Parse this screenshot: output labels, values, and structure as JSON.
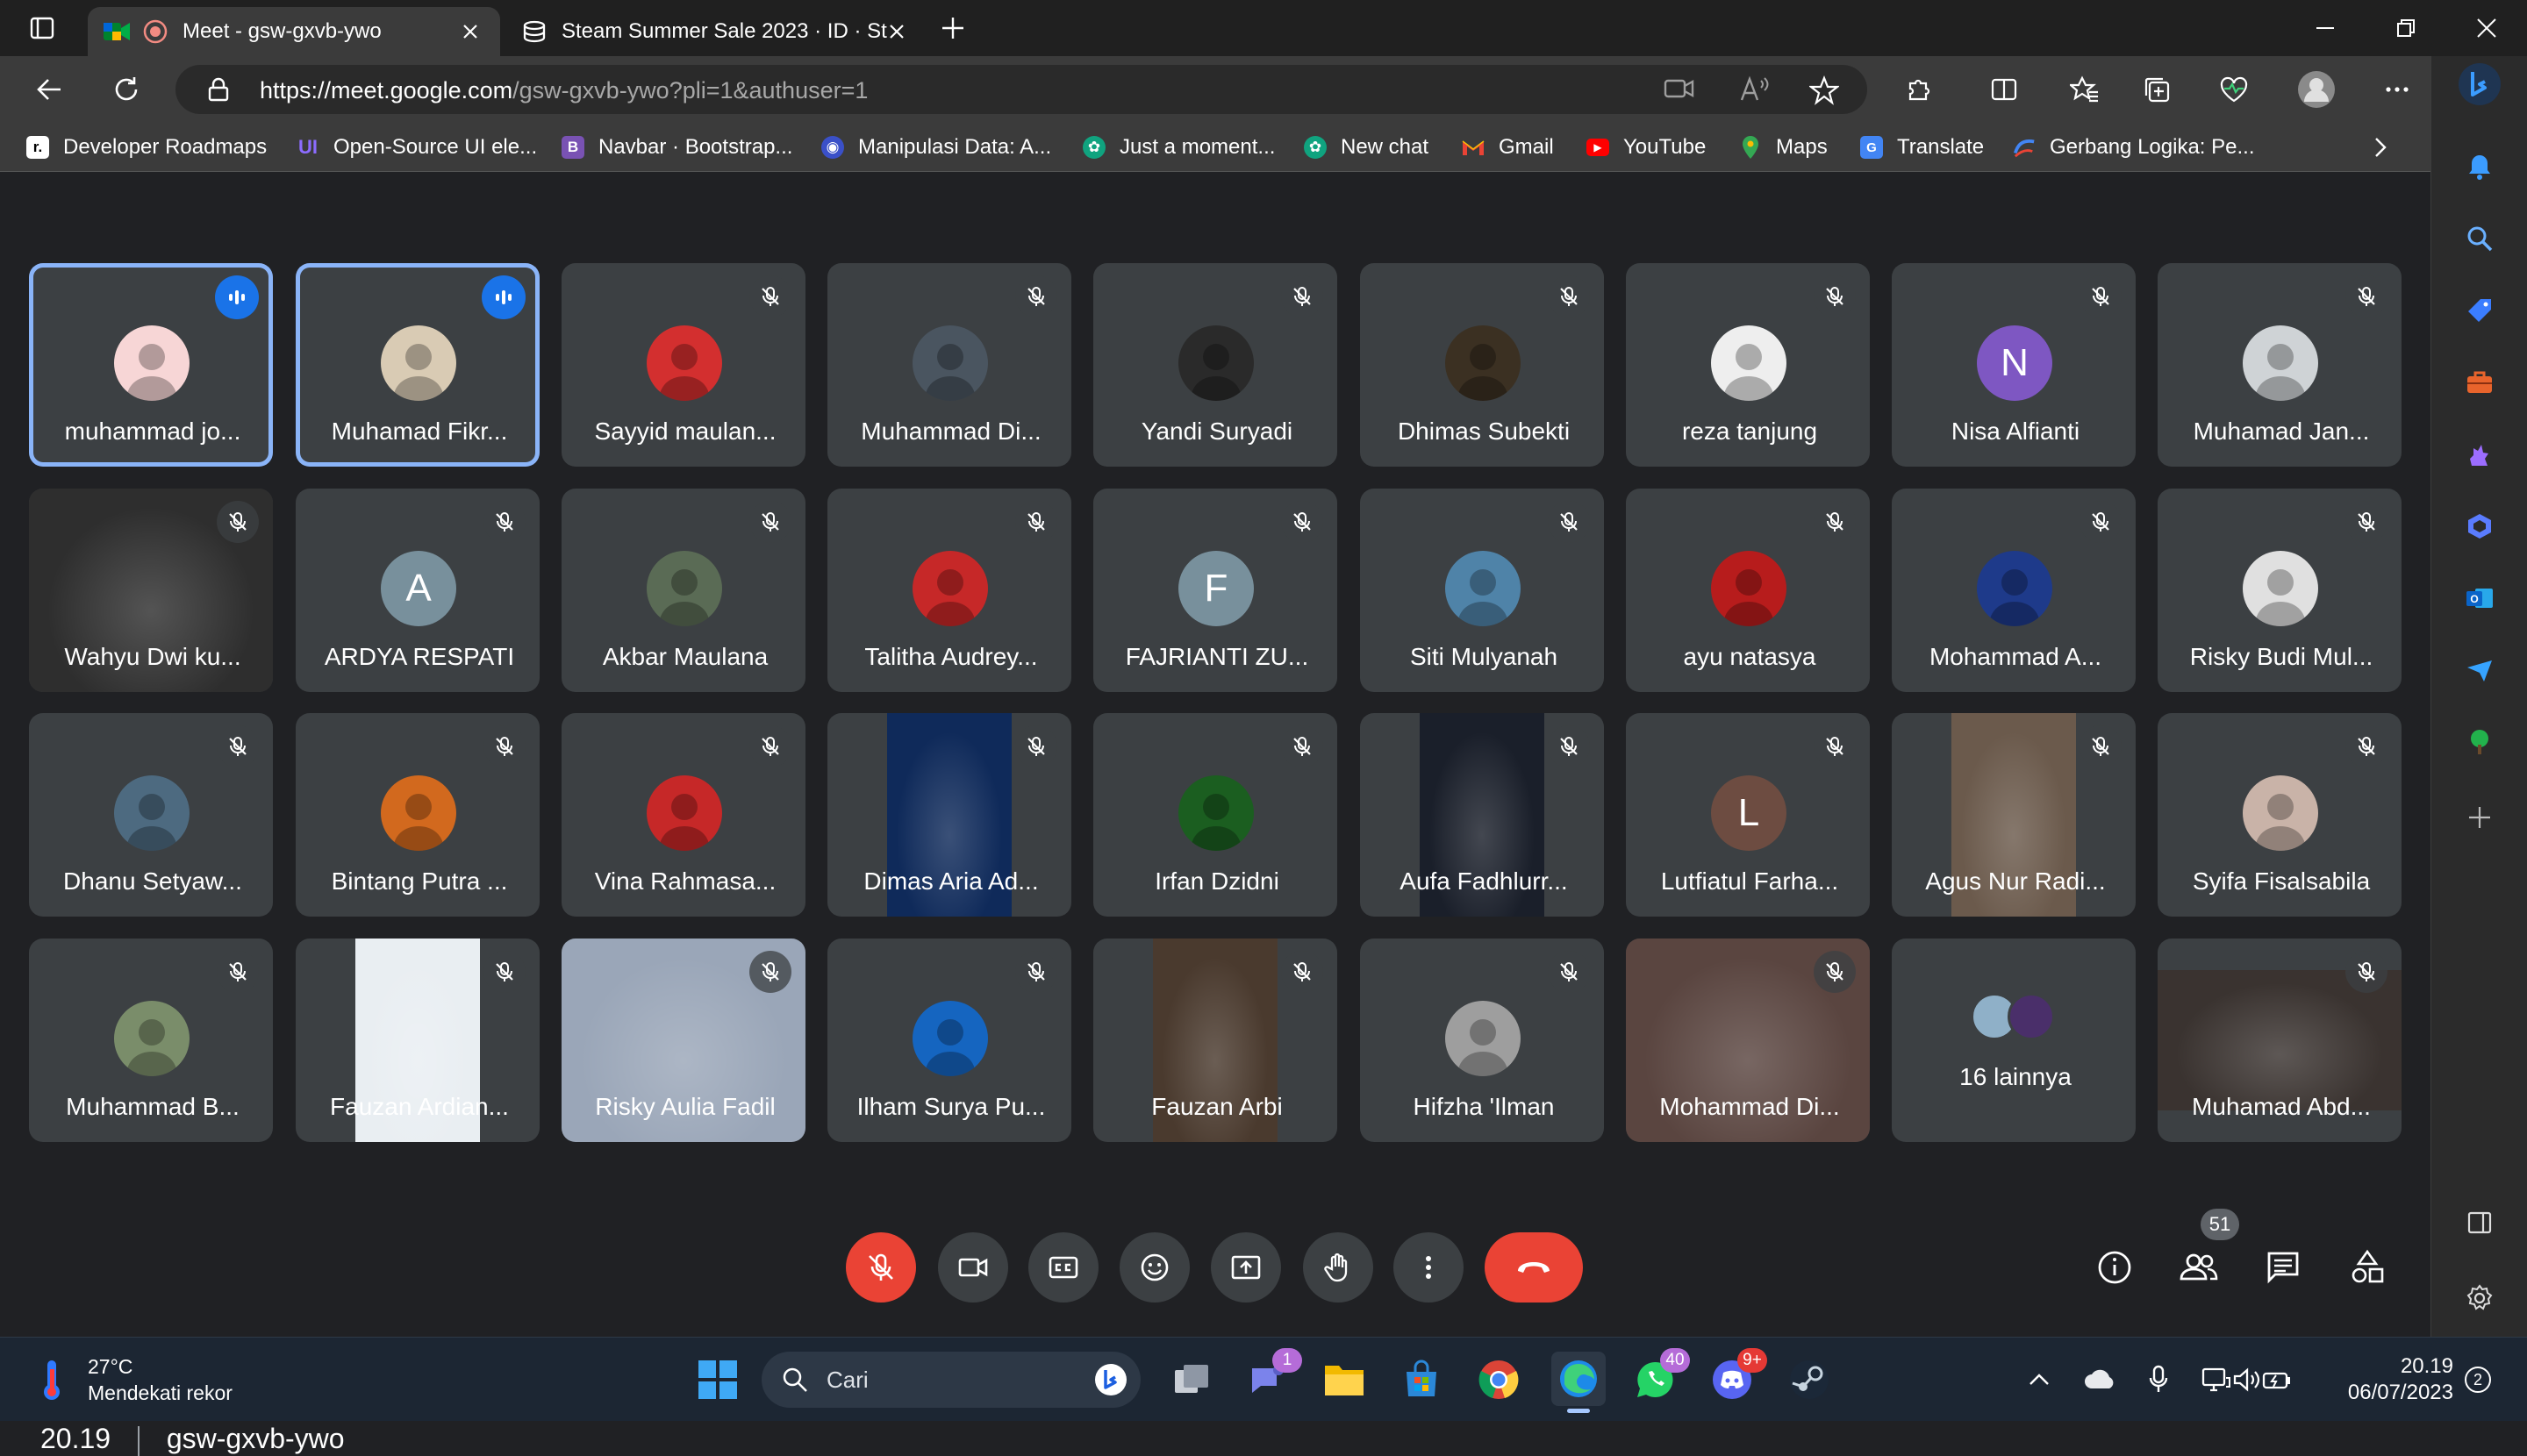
{
  "browser": {
    "tabs": [
      {
        "title": "Meet - gsw-gxvb-ywo",
        "active": true
      },
      {
        "title": "Steam Summer Sale 2023 · ID · St",
        "active": false
      }
    ],
    "url_domain": "https://meet.google.com",
    "url_path": "/gsw-gxvb-ywo?pli=1&authuser=1",
    "bookmarks": [
      {
        "label": "Developer Roadmaps",
        "icon": "roadmap-icon",
        "color": "#ffffff"
      },
      {
        "label": "Open-Source UI ele...",
        "icon": "ui-icon",
        "color": "#5b4cf0"
      },
      {
        "label": "Navbar · Bootstrap...",
        "icon": "bootstrap-icon",
        "color": "#7952b3"
      },
      {
        "label": "Manipulasi Data: A...",
        "icon": "globe-icon",
        "color": "#3a50c8"
      },
      {
        "label": "Just a moment...",
        "icon": "chatgpt-icon",
        "color": "#10a37f"
      },
      {
        "label": "New chat",
        "icon": "chatgpt-icon",
        "color": "#10a37f"
      },
      {
        "label": "Gmail",
        "icon": "gmail-icon",
        "color": "#ea4335"
      },
      {
        "label": "YouTube",
        "icon": "youtube-icon",
        "color": "#ff0000"
      },
      {
        "label": "Maps",
        "icon": "maps-icon",
        "color": "#34a853"
      },
      {
        "label": "Translate",
        "icon": "translate-icon",
        "color": "#4285f4"
      },
      {
        "label": "Gerbang Logika: Pe...",
        "icon": "site-icon",
        "color": "#4285f4"
      }
    ]
  },
  "meet": {
    "participants": [
      {
        "name": "muhammad jo...",
        "speaking": true,
        "avatar_color": "#f7d6d6",
        "avatar_type": "img"
      },
      {
        "name": "Muhamad Fikr...",
        "speaking": true,
        "avatar_color": "#d9cbb4",
        "avatar_type": "img"
      },
      {
        "name": "Sayyid maulan...",
        "avatar_color": "#d32f2f",
        "avatar_type": "img"
      },
      {
        "name": "Muhammad Di...",
        "avatar_color": "#4a5560",
        "avatar_type": "img"
      },
      {
        "name": "Yandi Suryadi",
        "avatar_color": "#2a2a2a",
        "avatar_type": "img"
      },
      {
        "name": "Dhimas Subekti",
        "avatar_color": "#3b3022",
        "avatar_type": "img"
      },
      {
        "name": "reza tanjung",
        "avatar_color": "#eeeeee",
        "avatar_type": "img"
      },
      {
        "name": "Nisa Alfianti",
        "avatar_color": "#7e57c2",
        "avatar_type": "letter",
        "letter": "N"
      },
      {
        "name": "Muhamad Jan...",
        "avatar_color": "#cfd3d6",
        "avatar_type": "img"
      },
      {
        "name": "Wahyu Dwi ku...",
        "avatar_type": "video",
        "video_color": "#2e2e2e"
      },
      {
        "name": "ARDYA RESPATI",
        "avatar_color": "#78909c",
        "avatar_type": "letter",
        "letter": "A"
      },
      {
        "name": "Akbar Maulana",
        "avatar_color": "#5a6b55",
        "avatar_type": "img"
      },
      {
        "name": "Talitha Audrey...",
        "avatar_color": "#c62828",
        "avatar_type": "img"
      },
      {
        "name": "FAJRIANTI ZU...",
        "avatar_color": "#78909c",
        "avatar_type": "letter",
        "letter": "F"
      },
      {
        "name": "Siti Mulyanah",
        "avatar_color": "#4f83a8",
        "avatar_type": "img"
      },
      {
        "name": "ayu natasya",
        "avatar_color": "#b71c1c",
        "avatar_type": "img"
      },
      {
        "name": "Mohammad A...",
        "avatar_color": "#1e3a8a",
        "avatar_type": "img"
      },
      {
        "name": "Risky Budi Mul...",
        "avatar_color": "#e0e0e0",
        "avatar_type": "img"
      },
      {
        "name": "Dhanu Setyaw...",
        "avatar_color": "#4d6a80",
        "avatar_type": "img"
      },
      {
        "name": "Bintang Putra ...",
        "avatar_color": "#d2691e",
        "avatar_type": "img"
      },
      {
        "name": "Vina Rahmasa...",
        "avatar_color": "#c62828",
        "avatar_type": "img"
      },
      {
        "name": "Dimas Aria Ad...",
        "avatar_type": "video",
        "video_color": "#0f2a5a"
      },
      {
        "name": "Irfan Dzidni",
        "avatar_color": "#1b5e20",
        "avatar_type": "img"
      },
      {
        "name": "Aufa Fadhlurr...",
        "avatar_type": "video",
        "video_color": "#1a1f2a"
      },
      {
        "name": "Lutfiatul Farha...",
        "avatar_color": "#6d4c41",
        "avatar_type": "letter",
        "letter": "L"
      },
      {
        "name": "Agus Nur Radi...",
        "avatar_type": "video",
        "video_color": "#6b5a4c"
      },
      {
        "name": "Syifa Fisalsabila",
        "avatar_color": "#c9b3a8",
        "avatar_type": "img"
      },
      {
        "name": "Muhammad B...",
        "avatar_color": "#7a8d6a",
        "avatar_type": "img"
      },
      {
        "name": "Fauzan Ardian...",
        "avatar_type": "video",
        "video_color": "#e9eef2"
      },
      {
        "name": "Risky Aulia Fadil",
        "avatar_type": "video",
        "video_color": "#9aa6b8"
      },
      {
        "name": "Ilham Surya Pu...",
        "avatar_color": "#1565c0",
        "avatar_type": "img"
      },
      {
        "name": "Fauzan Arbi",
        "avatar_type": "video",
        "video_color": "#4a3a2e"
      },
      {
        "name": "Hifzha 'Ilman",
        "avatar_color": "#9e9e9e",
        "avatar_type": "img"
      },
      {
        "name": "Mohammad Di...",
        "avatar_type": "video",
        "video_color": "#5a4540"
      },
      {
        "name": "16 lainnya",
        "avatar_type": "others"
      },
      {
        "name": "Muhamad Abd...",
        "avatar_type": "video",
        "video_color": "#3a3330"
      }
    ],
    "meeting_time": "20.19",
    "meeting_code": "gsw-gxvb-ywo",
    "people_count": "51"
  },
  "taskbar": {
    "weather_temp": "27°C",
    "weather_desc": "Mendekati rekor",
    "search_placeholder": "Cari",
    "teams_badge": "1",
    "whatsapp_badge": "40",
    "discord_badge": "9+",
    "clock_time": "20.19",
    "clock_date": "06/07/2023",
    "notification_count": "2"
  }
}
